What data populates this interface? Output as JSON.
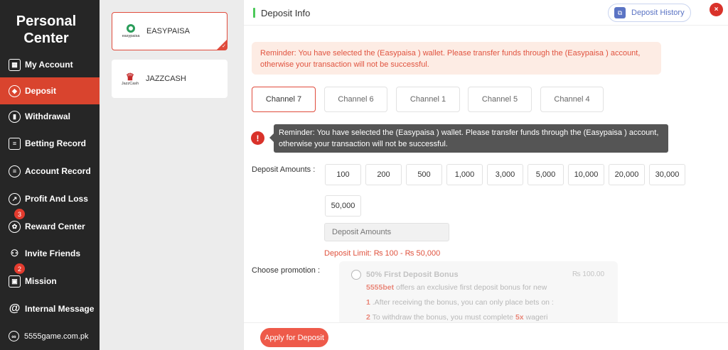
{
  "sidebar": {
    "title_line1": "Personal",
    "title_line2": "Center",
    "items": [
      {
        "label": "My Account",
        "icon": "account-icon"
      },
      {
        "label": "Deposit",
        "icon": "deposit-icon",
        "active": true
      },
      {
        "label": "Withdrawal",
        "icon": "withdrawal-icon"
      },
      {
        "label": "Betting Record",
        "icon": "betting-record-icon"
      },
      {
        "label": "Account Record",
        "icon": "account-record-icon"
      },
      {
        "label": "Profit And Loss",
        "icon": "profit-loss-icon"
      },
      {
        "label": "Reward Center",
        "icon": "reward-icon",
        "badge": "3"
      },
      {
        "label": "Invite Friends",
        "icon": "invite-icon"
      },
      {
        "label": "Mission",
        "icon": "gift-icon",
        "badge": "2"
      },
      {
        "label": "Internal Message",
        "icon": "at-sign-icon"
      }
    ],
    "footer": "5555game.com.pk"
  },
  "wallets": [
    {
      "name": "EASYPAISA",
      "logo_text": "easypaisa",
      "selected": true
    },
    {
      "name": "JAZZCASH",
      "logo_text": "JazzCash",
      "selected": false
    }
  ],
  "header": {
    "title": "Deposit Info",
    "history_label": "Deposit History",
    "close": "×"
  },
  "reminder": "Reminder: You have selected the (Easypaisa ) wallet. Please transfer funds through the (Easypaisa ) account, otherwise your transaction will not be successful.",
  "channels": [
    "Channel 7",
    "Channel 6",
    "Channel 1",
    "Channel 5",
    "Channel 4"
  ],
  "tooltip": "Reminder: You have selected the (Easypaisa ) wallet. Please transfer funds through the (Easypaisa ) account, otherwise your transaction will not be successful.",
  "deposit": {
    "label": "Deposit Amounts :",
    "amounts": [
      "100",
      "200",
      "500",
      "1,000",
      "3,000",
      "5,000",
      "10,000",
      "20,000",
      "30,000",
      "50,000"
    ],
    "placeholder": "Deposit Amounts",
    "limit": "Deposit Limit:  ₨ 100  -  ₨ 50,000"
  },
  "promotion": {
    "label": "Choose promotion :",
    "title": "50% First Deposit Bonus",
    "amount": "₨  100.00",
    "brand": "5555bet",
    "line1": " offers an exclusive first deposit bonus for new",
    "n1": "1",
    "line2": " .After receiving the bonus, you can only place bets on :",
    "n2": "2",
    "line3": " To withdraw the bonus, you must complete ",
    "mult": "5x",
    "line3b": " wageri"
  },
  "apply_label": "Apply for Deposit"
}
